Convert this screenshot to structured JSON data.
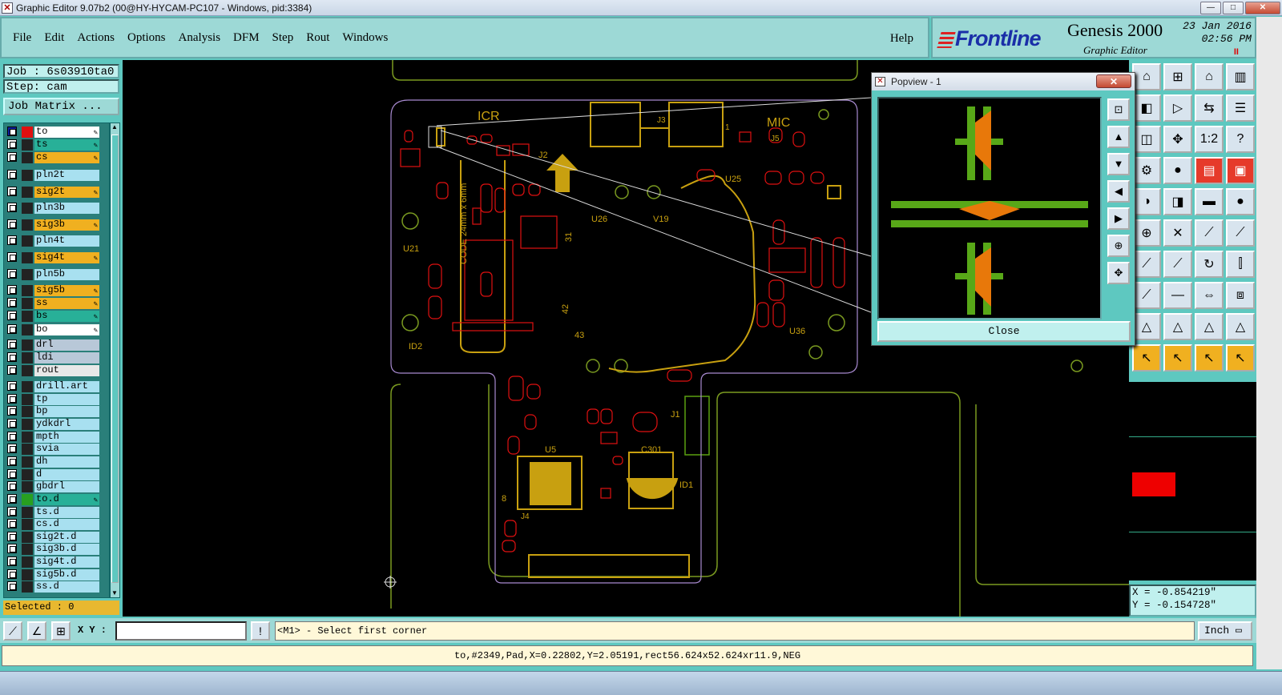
{
  "window": {
    "title": "Graphic Editor 9.07b2 (00@HY-HYCAM-PC107 - Windows, pid:3384)",
    "minimize": "—",
    "maximize": "□",
    "close": "✕"
  },
  "menu": {
    "items": [
      "File",
      "Edit",
      "Actions",
      "Options",
      "Analysis",
      "DFM",
      "Step",
      "Rout",
      "Windows"
    ],
    "help": "Help"
  },
  "brand": {
    "logo": "Frontline",
    "product": "Genesis 2000",
    "subtitle": "Graphic Editor",
    "date": "23 Jan 2016",
    "time": "02:56 PM",
    "pause": "II"
  },
  "left_panel": {
    "job": "Job : 6s03910ta0",
    "step": "Step: cam",
    "job_matrix": "Job Matrix ...",
    "selected": "Selected : 0",
    "layers": [
      {
        "name": "to",
        "bg": "#ffffff",
        "color": "#e01010",
        "active": true
      },
      {
        "name": "ts",
        "bg": "#28b098",
        "color": "#222222"
      },
      {
        "name": "cs",
        "bg": "#f0b020",
        "color": "#222222"
      },
      {
        "name": "pln2t",
        "bg": "#a8e0f0",
        "color": "#222222"
      },
      {
        "name": "sig2t",
        "bg": "#f0b020",
        "color": "#222222"
      },
      {
        "name": "pln3b",
        "bg": "#a8e0f0",
        "color": "#222222"
      },
      {
        "name": "sig3b",
        "bg": "#f0b020",
        "color": "#222222"
      },
      {
        "name": "pln4t",
        "bg": "#a8e0f0",
        "color": "#222222"
      },
      {
        "name": "sig4t",
        "bg": "#f0b020",
        "color": "#222222"
      },
      {
        "name": "pln5b",
        "bg": "#a8e0f0",
        "color": "#222222"
      },
      {
        "name": "sig5b",
        "bg": "#f0b020",
        "color": "#222222"
      },
      {
        "name": "ss",
        "bg": "#f0b020",
        "color": "#222222"
      },
      {
        "name": "bs",
        "bg": "#28b098",
        "color": "#222222"
      },
      {
        "name": "bo",
        "bg": "#ffffff",
        "color": "#222222"
      },
      {
        "name": "drl",
        "bg": "#b8c8d8",
        "color": "#222222"
      },
      {
        "name": "ldi",
        "bg": "#b8c8d8",
        "color": "#222222"
      },
      {
        "name": "rout",
        "bg": "#e8e8e8",
        "color": "#222222"
      },
      {
        "name": "drill.art",
        "bg": "#a8e0f0",
        "color": "#222222"
      },
      {
        "name": "tp",
        "bg": "#a8e0f0",
        "color": "#222222"
      },
      {
        "name": "bp",
        "bg": "#a8e0f0",
        "color": "#222222"
      },
      {
        "name": "ydkdrl",
        "bg": "#a8e0f0",
        "color": "#222222"
      },
      {
        "name": "mpth",
        "bg": "#a8e0f0",
        "color": "#222222"
      },
      {
        "name": "svia",
        "bg": "#a8e0f0",
        "color": "#222222"
      },
      {
        "name": "dh",
        "bg": "#a8e0f0",
        "color": "#222222"
      },
      {
        "name": "d",
        "bg": "#a8e0f0",
        "color": "#222222"
      },
      {
        "name": "gbdrl",
        "bg": "#a8e0f0",
        "color": "#222222"
      },
      {
        "name": "to.d",
        "bg": "#28b098",
        "color": "#28a020"
      },
      {
        "name": "ts.d",
        "bg": "#a8e0f0",
        "color": "#222222"
      },
      {
        "name": "cs.d",
        "bg": "#a8e0f0",
        "color": "#222222"
      },
      {
        "name": "sig2t.d",
        "bg": "#a8e0f0",
        "color": "#222222"
      },
      {
        "name": "sig3b.d",
        "bg": "#a8e0f0",
        "color": "#222222"
      },
      {
        "name": "sig4t.d",
        "bg": "#a8e0f0",
        "color": "#222222"
      },
      {
        "name": "sig5b.d",
        "bg": "#a8e0f0",
        "color": "#222222"
      },
      {
        "name": "ss.d",
        "bg": "#a8e0f0",
        "color": "#222222"
      }
    ]
  },
  "canvas": {
    "labels": [
      "ICR",
      "MIC",
      "J2",
      "J3",
      "J5",
      "U21",
      "U25",
      "U26",
      "U36",
      "V19",
      "CODE 24mm x 6mm",
      "ID2",
      "ID1",
      "U5",
      "C301",
      "J1",
      "J4",
      "31",
      "42",
      "43",
      "8",
      "1"
    ]
  },
  "popview": {
    "title": "Popview - 1",
    "close_x": "✕",
    "close_button": "Close"
  },
  "coords": {
    "x": "X = -0.854219\"",
    "y": "Y = -0.154728\""
  },
  "bottom": {
    "xy_label": "X Y :",
    "xy_value": "",
    "warn_icon": "!",
    "prompt": "<M1> - Select first corner",
    "units": "Inch",
    "status": "to,#2349,Pad,X=0.22802,Y=2.05191,rect56.624x52.624xr11.9,NEG"
  },
  "colors": {
    "panel": "#5ec8c0",
    "menu_bg": "#9dd9d6",
    "pad_red": "#e01010",
    "copper_yellow": "#c8a010",
    "outline_green": "#7a9a20",
    "outline_violet": "#a88ad0",
    "popview_green": "#58a818"
  }
}
